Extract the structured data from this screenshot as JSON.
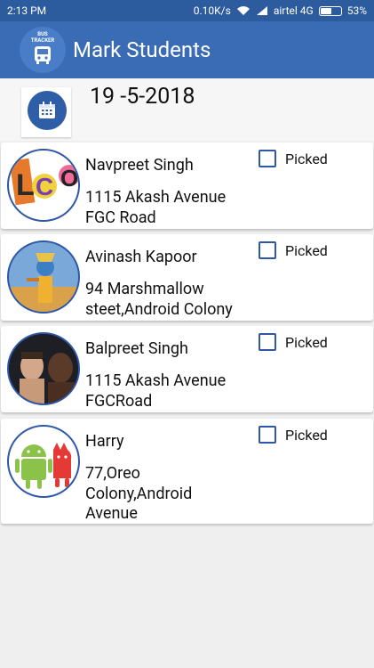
{
  "status_bar": {
    "time": "2:13 PM",
    "net_speed": "0.10K/s",
    "carrier": "airtel 4G",
    "battery": "53%"
  },
  "app_bar": {
    "logo_text_line1": "BUS",
    "logo_text_line2": "TRACKER",
    "title": "Mark Students",
    "color": "#3a6bb5"
  },
  "date": {
    "icon": "calendar-icon",
    "value": "19 -5-2018"
  },
  "students": [
    {
      "name": "Navpreet Singh",
      "address": "1115 Akash Avenue FGC Road",
      "checkbox_label": "Picked",
      "checked": false,
      "avatar": "lco-logo-avatar"
    },
    {
      "name": "Avinash Kapoor",
      "address": "94 Marshmallow steet,Android Colony",
      "checkbox_label": "Picked",
      "checked": false,
      "avatar": "krishna-avatar"
    },
    {
      "name": "Balpreet Singh",
      "address": "1115 Akash Avenue FGCRoad",
      "checkbox_label": "Picked",
      "checked": false,
      "avatar": "boxers-avatar"
    },
    {
      "name": "Harry",
      "address": "77,Oreo Colony,Android Avenue",
      "checkbox_label": "Picked",
      "checked": false,
      "avatar": "android-avatar"
    }
  ]
}
